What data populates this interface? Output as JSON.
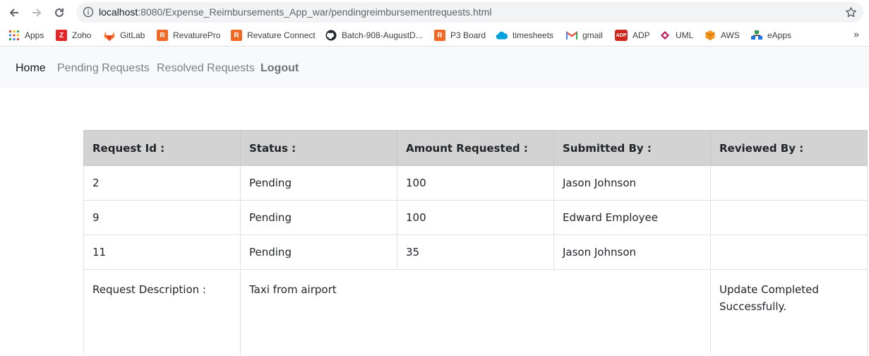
{
  "browser": {
    "url_host": "localhost",
    "url_rest": ":8080/Expense_Reimbursements_App_war/pendingreimbursementrequests.html"
  },
  "bookmarks": [
    {
      "label": "Apps",
      "icon": "apps-grid-icon",
      "color": "#1a73e8"
    },
    {
      "label": "Zoho",
      "icon": "zoho-icon",
      "color": "#e42527"
    },
    {
      "label": "GitLab",
      "icon": "gitlab-icon",
      "color": "#fc6d26"
    },
    {
      "label": "RevaturePro",
      "icon": "revature-icon",
      "color": "#f26925"
    },
    {
      "label": "Revature Connect",
      "icon": "revature-icon",
      "color": "#f26925"
    },
    {
      "label": "Batch-908-AugustD...",
      "icon": "github-icon",
      "color": "#24292e"
    },
    {
      "label": "P3 Board",
      "icon": "revature-icon",
      "color": "#f26925"
    },
    {
      "label": "timesheets",
      "icon": "salesforce-cloud-icon",
      "color": "#00a1e0"
    },
    {
      "label": "gmail",
      "icon": "gmail-icon",
      "color": "#ea4335"
    },
    {
      "label": "ADP",
      "icon": "adp-icon",
      "color": "#d0271d"
    },
    {
      "label": "UML",
      "icon": "uml-diamond-icon",
      "color": "#c2185b"
    },
    {
      "label": "AWS",
      "icon": "aws-cube-icon",
      "color": "#f7981d"
    },
    {
      "label": "eApps",
      "icon": "eapps-icon",
      "color": "#2e9e4f"
    }
  ],
  "nav": {
    "home": "Home",
    "pending": "Pending Requests",
    "resolved": "Resolved Requests",
    "logout": "Logout"
  },
  "table": {
    "headers": [
      "Request Id :",
      "Status :",
      "Amount Requested :",
      "Submitted By :",
      "Reviewed By :"
    ],
    "rows": [
      {
        "id": "2",
        "status": "Pending",
        "amount": "100",
        "submitted_by": "Jason Johnson",
        "reviewed_by": ""
      },
      {
        "id": "9",
        "status": "Pending",
        "amount": "100",
        "submitted_by": "Edward Employee",
        "reviewed_by": ""
      },
      {
        "id": "11",
        "status": "Pending",
        "amount": "35",
        "submitted_by": "Jason Johnson",
        "reviewed_by": ""
      }
    ],
    "description_label": "Request Description :",
    "description_value": "Taxi from airport",
    "update_message": "Update Completed Successfully."
  },
  "colors": {
    "header_bg": "#d3d3d3",
    "navbar_bg": "#f8f9fa"
  }
}
